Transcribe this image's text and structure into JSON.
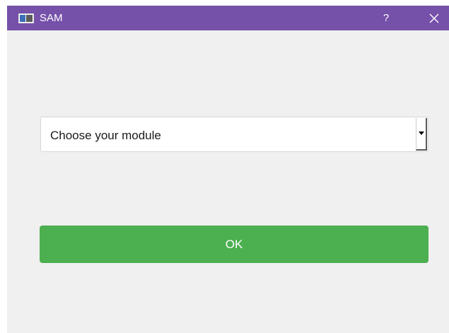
{
  "window": {
    "title": "SAM",
    "app_icon": "window-app-icon",
    "help_label": "?",
    "close_icon": "close-icon",
    "titlebar_color": "#7651aa"
  },
  "module_select": {
    "value": "Choose your module",
    "arrow_icon": "dropdown-arrow-icon"
  },
  "ok_button": {
    "label": "OK",
    "color": "#4caf50"
  }
}
